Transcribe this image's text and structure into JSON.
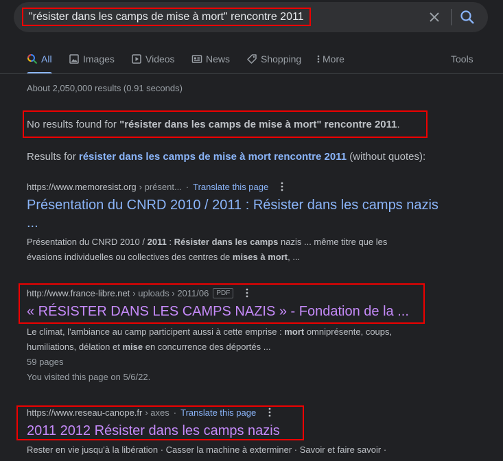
{
  "search": {
    "query": "\"résister dans les camps de mise à mort\" rencontre 2011"
  },
  "tabs": [
    {
      "label": "All",
      "icon": "search-icon"
    },
    {
      "label": "Images",
      "icon": "image-icon"
    },
    {
      "label": "Videos",
      "icon": "play-icon"
    },
    {
      "label": "News",
      "icon": "news-icon"
    },
    {
      "label": "Shopping",
      "icon": "tag-icon"
    },
    {
      "label": "More",
      "icon": "more-vert-icon"
    }
  ],
  "tools_label": "Tools",
  "stats": "About 2,050,000 results (0.91 seconds)",
  "notice": {
    "prefix": "No results found for ",
    "query": "\"résister dans les camps de mise à mort\" rencontre 2011",
    "suffix": "."
  },
  "results_for": {
    "prefix": "Results for ",
    "query": "résister dans les camps de mise à mort rencontre 2011",
    "suffix": " (without quotes):"
  },
  "results": [
    {
      "domain": "https://www.memoresist.org",
      "path": "› présent...",
      "translate": "Translate this page",
      "title_line1": "Présentation du CNRD 2010 / 2011 : Résister dans les camps nazis",
      "title_line2": "...",
      "snippet_a": "Présentation du CNRD 2010 / ",
      "snippet_b": "2011",
      "snippet_c": " : ",
      "snippet_d": "Résister dans les camps",
      "snippet_e": " nazis ... même titre que les",
      "snippet_f": "évasions individuelles ou collectives des centres de ",
      "snippet_g": "mises à mort",
      "snippet_h": ", ..."
    },
    {
      "domain": "http://www.france-libre.net",
      "path": "› uploads › 2011/06",
      "badge": "PDF",
      "title": "« RÉSISTER DANS LES CAMPS NAZIS » - Fondation de la ...",
      "snippet_a": "Le climat, l'ambiance au camp participent aussi à cette emprise : ",
      "snippet_b": "mort",
      "snippet_c": " omniprésente, coups,",
      "snippet_d": "humiliations, délation et ",
      "snippet_e": "mise",
      "snippet_f": " en concurrence des déportés ...",
      "pages": "59 pages",
      "visited": "You visited this page on 5/6/22."
    },
    {
      "domain": "https://www.reseau-canope.fr",
      "path": "› axes",
      "translate": "Translate this page",
      "title": "2011 2012 Résister dans les camps nazis",
      "snippet": "Rester en vie jusqu'à la libération · Casser la machine à exterminer · Savoir et faire savoir ·"
    }
  ],
  "colors": {
    "background": "#202124",
    "link": "#8ab4f8",
    "visited_link": "#c58af9",
    "highlight_box": "#e00000"
  }
}
